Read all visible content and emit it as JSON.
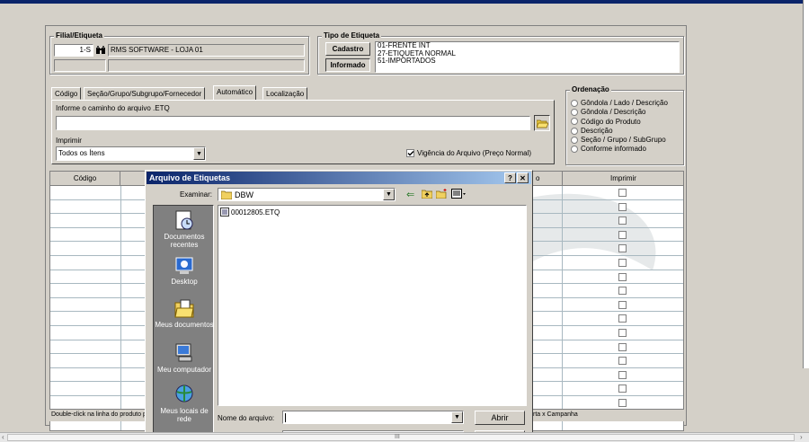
{
  "filial": {
    "title": "Filial/Etiqueta",
    "code": "1-S",
    "name": "RMS SOFTWARE - LOJA 01"
  },
  "tipo": {
    "title": "Tipo de Etiqueta",
    "cadastro_btn": "Cadastro",
    "informado_btn": "Informado",
    "lines": [
      "01-FRENTE INT",
      "27-ETIQUETA NORMAL",
      "51-IMPORTADOS"
    ]
  },
  "tabs": [
    "Código",
    "Seção/Grupo/Subgrupo/Fornecedor",
    "Automático",
    "Localização"
  ],
  "auto": {
    "path_label": "Informe o caminho do arquivo .ETQ",
    "path_value": "",
    "print_label": "Imprimir",
    "print_value": "Todos os Ítens",
    "vigencia_label": "Vigência do Arquivo (Preço Normal)",
    "vigencia_checked": true
  },
  "ordenacao": {
    "title": "Ordenação",
    "options": [
      "Gôndola / Lado / Descrição",
      "Gôndola / Descrição",
      "Código do Produto",
      "Descrição",
      "Seção / Grupo / SubGrupo",
      "Conforme informado"
    ]
  },
  "grid": {
    "col_codigo": "Código",
    "col_o_partial": "o",
    "col_imprimir": "Imprimir",
    "row_count": 16
  },
  "status": {
    "left": "Double-click na linha do produto p",
    "right": "rta x Campanha"
  },
  "dialog": {
    "title": "Arquivo de Etiquetas",
    "examinar_label": "Examinar:",
    "folder": "DBW",
    "files": [
      "00012805.ETQ"
    ],
    "sidebar": [
      {
        "label": "Documentos recentes"
      },
      {
        "label": "Desktop"
      },
      {
        "label": "Meus documentos"
      },
      {
        "label": "Meu computador"
      },
      {
        "label": "Meus locais de rede"
      }
    ],
    "filename_label": "Nome do arquivo:",
    "filename_value": "",
    "open_btn": "Abrir",
    "help_btn": "?",
    "close_btn": "✕"
  },
  "scrollbar": {
    "grip": "III"
  }
}
